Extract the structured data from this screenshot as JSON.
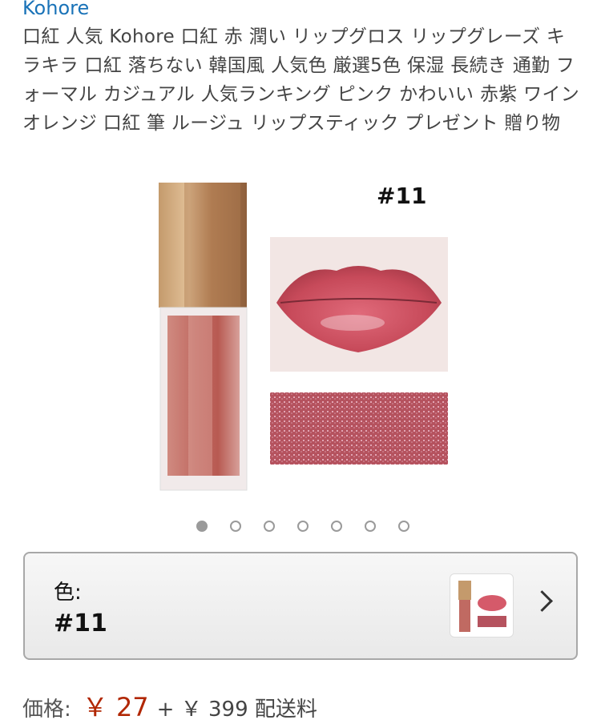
{
  "brand": "Kohore",
  "title": "口紅 人気 Kohore 口紅 赤 潤い リップグロス リップグレーズ キラキラ 口紅 落ちない 韓国風 人気色 厳選5色 保湿 長続き 通勤 フォーマル カジュアル 人気ランキング ピンク かわいい 赤紫 ワイン オレンジ 口紅 筆 ルージュ リップスティック プレゼント 贈り物",
  "image": {
    "variant_label": "#11"
  },
  "carousel": {
    "count": 7,
    "active_index": 0
  },
  "selector": {
    "label": "色:",
    "value": "#11",
    "icon": "chevron-right-icon"
  },
  "price": {
    "label": "価格:",
    "value": "￥ 27",
    "shipping": "+ ￥ 399 配送料"
  },
  "colors": {
    "brand_link": "#1a73b8",
    "price": "#b12704"
  }
}
